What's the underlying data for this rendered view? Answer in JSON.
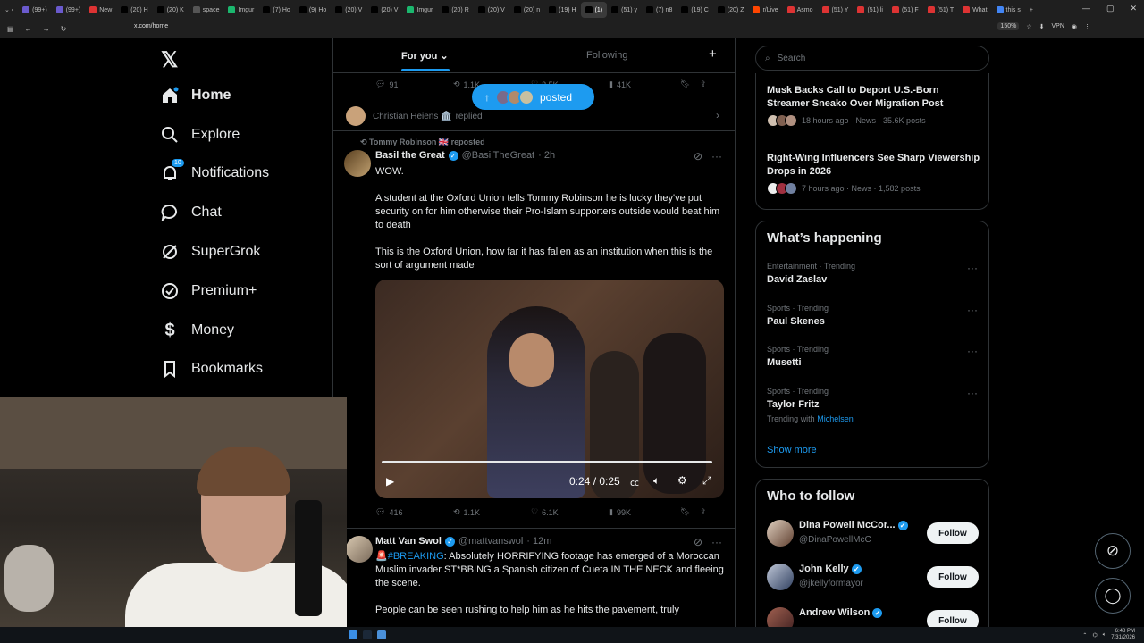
{
  "browser": {
    "tabs": [
      {
        "label": "(99+)",
        "color": "#6a5acd"
      },
      {
        "label": "(99+)",
        "color": "#6a5acd"
      },
      {
        "label": "New",
        "color": "#d33"
      },
      {
        "label": "(20) H",
        "color": "#000"
      },
      {
        "label": "(20) K",
        "color": "#000"
      },
      {
        "label": "space",
        "color": "#555"
      },
      {
        "label": "Imgur",
        "color": "#1bb76e"
      },
      {
        "label": "(7) Ho",
        "color": "#000"
      },
      {
        "label": "(9) Ho",
        "color": "#000"
      },
      {
        "label": "(20) V",
        "color": "#000"
      },
      {
        "label": "(20) V",
        "color": "#000"
      },
      {
        "label": "Imgur",
        "color": "#1bb76e"
      },
      {
        "label": "(20) R",
        "color": "#000"
      },
      {
        "label": "(20) V",
        "color": "#000"
      },
      {
        "label": "(20) n",
        "color": "#000"
      },
      {
        "label": "(19) H",
        "color": "#000"
      },
      {
        "label": "(1)",
        "color": "#000"
      },
      {
        "label": "(51) y",
        "color": "#000"
      },
      {
        "label": "(7) n8",
        "color": "#000"
      },
      {
        "label": "(19) C",
        "color": "#000"
      },
      {
        "label": "(20) Z",
        "color": "#000"
      },
      {
        "label": "r/Live",
        "color": "#ff4500"
      },
      {
        "label": "Asmo",
        "color": "#d33"
      },
      {
        "label": "(51) Y",
        "color": "#d33"
      },
      {
        "label": "(51) li",
        "color": "#d33"
      },
      {
        "label": "(51) F",
        "color": "#d33"
      },
      {
        "label": "(51) T",
        "color": "#d33"
      },
      {
        "label": "What",
        "color": "#d33"
      },
      {
        "label": "this s",
        "color": "#4285f4"
      }
    ],
    "url": "x.com/home",
    "zoom": "150%",
    "vpn": "VPN"
  },
  "nav": {
    "items": [
      {
        "label": "Home"
      },
      {
        "label": "Explore"
      },
      {
        "label": "Notifications",
        "badge": "10"
      },
      {
        "label": "Chat"
      },
      {
        "label": "SuperGrok"
      },
      {
        "label": "Premium+"
      },
      {
        "label": "Money"
      },
      {
        "label": "Bookmarks"
      }
    ]
  },
  "timeline": {
    "tab_foryou": "For you",
    "tab_following": "Following",
    "prev_actions": {
      "replies": "91",
      "reposts": "1.1K",
      "likes": "3.5K",
      "views": "41K"
    },
    "posted_pill": "posted",
    "reply_row": {
      "name": "Christian Heiens 🏛️",
      "action": "replied"
    },
    "tweet1": {
      "repost_by": "Tommy Robinson 🇬🇧 reposted",
      "name": "Basil the Great",
      "handle": "@BasilTheGreat",
      "time": "· 2h",
      "line1": "WOW.",
      "line2": "A student at the Oxford Union tells Tommy Robinson he is lucky they've put security on for him otherwise their Pro-Islam supporters outside would beat him to death",
      "line3": "This is the Oxford Union, how far it has fallen as an institution when this is the sort of argument made",
      "video_time": "0:24 / 0:25",
      "actions": {
        "replies": "416",
        "reposts": "1.1K",
        "likes": "6.1K",
        "views": "99K"
      }
    },
    "tweet2": {
      "name": "Matt Van Swol",
      "handle": "@mattvanswol",
      "time": "· 12m",
      "line1_prefix": "🚨",
      "hashtag": "#BREAKING",
      "line1": ": Absolutely HORRIFYING footage has emerged of a Moroccan Muslim invader ST*BBING a Spanish citizen of Cueta IN THE NECK and fleeing the scene.",
      "line2": "People can be seen rushing to help him as he hits the pavement, truly"
    }
  },
  "sidebar": {
    "search_placeholder": "Search",
    "news": [
      {
        "title": "Musk Backs Call to Deport U.S.-Born Streamer Sneako Over Migration Post",
        "meta": "18 hours ago · News · 35.6K posts"
      },
      {
        "title": "Right-Wing Influencers See Sharp Viewership Drops in 2026",
        "meta": "7 hours ago · News · 1,582 posts"
      }
    ],
    "happening_title": "What’s happening",
    "trends": [
      {
        "category": "Entertainment · Trending",
        "name": "David Zaslav"
      },
      {
        "category": "Sports · Trending",
        "name": "Paul Skenes"
      },
      {
        "category": "Sports · Trending",
        "name": "Musetti"
      },
      {
        "category": "Sports · Trending",
        "name": "Taylor Fritz",
        "with_label": "Trending with",
        "with_value": "Michelsen"
      }
    ],
    "show_more": "Show more",
    "wtf_title": "Who to follow",
    "wtf": [
      {
        "name": "Dina Powell McCor...",
        "handle": "@DinaPowellMcC",
        "button": "Follow"
      },
      {
        "name": "John Kelly",
        "handle": "@jkellyformayor",
        "button": "Follow"
      },
      {
        "name": "Andrew Wilson",
        "handle": "",
        "button": "Follow"
      }
    ]
  },
  "taskbar": {
    "time": "6:48 PM",
    "date": "7/31/2026"
  },
  "colors": {
    "accent": "#1d9bf0",
    "bg": "#000000",
    "border": "#2f3336",
    "muted": "#71767b"
  }
}
